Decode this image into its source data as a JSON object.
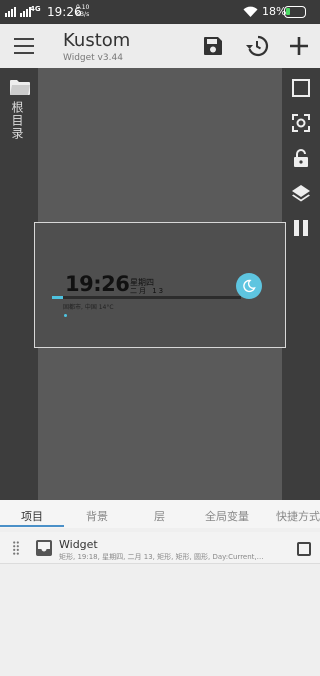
{
  "status_bar": {
    "network_type": "4G",
    "time": "19:26",
    "speed_value": "0.10",
    "speed_unit": "KB/s",
    "battery_percent": "18%"
  },
  "app_bar": {
    "title": "Kustom",
    "subtitle": "Widget v3.44",
    "icons": [
      "menu-icon",
      "save-icon",
      "history-icon",
      "add-icon"
    ]
  },
  "left_panel": {
    "folder_label": "根目录",
    "icon": "folder-icon"
  },
  "right_toolbar": [
    "square-icon",
    "focus-icon",
    "lock-icon",
    "layers-icon",
    "pause-icon"
  ],
  "preview": {
    "time": "19:26",
    "weekday": "星期四",
    "date": "二月 13",
    "location": "固都市, 中国 14°C",
    "progress": 0.06,
    "accent_color": "#4ec3e0"
  },
  "tabs": [
    {
      "label": "项目",
      "active": true
    },
    {
      "label": "背景",
      "active": false
    },
    {
      "label": "层",
      "active": false
    },
    {
      "label": "全局变量",
      "active": false
    },
    {
      "label": "快捷方式",
      "active": false
    }
  ],
  "items": [
    {
      "name": "Widget",
      "description": "矩形, 19:18, 星期四, 二月 13, 矩形, 矩形, 圆形, Day:Current,…",
      "checked": false
    }
  ],
  "colors": {
    "status_bar": "#3a3a3a",
    "editor_side": "#3d3d3d",
    "canvas": "#5a5a5a",
    "tab_indicator": "#4a90c8"
  }
}
